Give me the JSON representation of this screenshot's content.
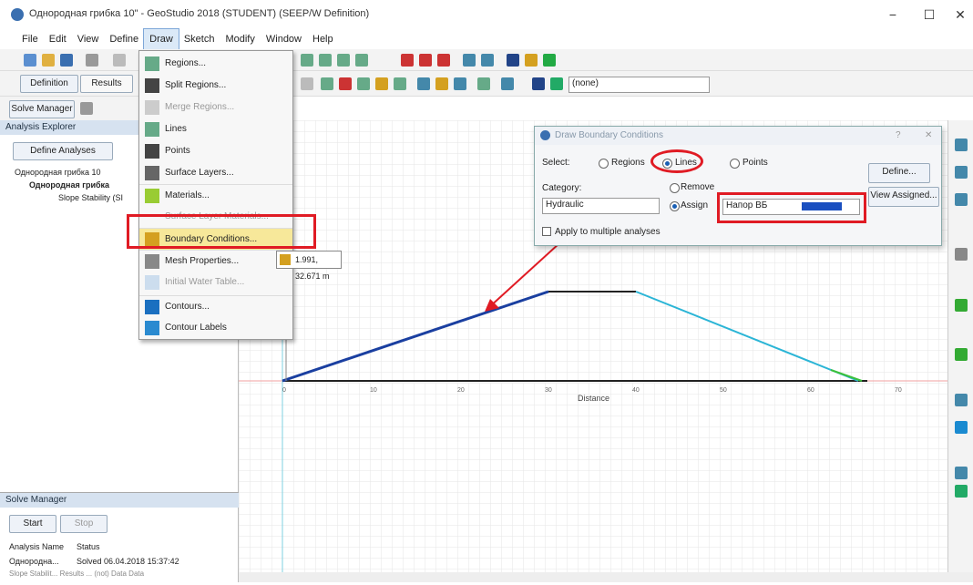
{
  "window": {
    "title": "Однородная грибка 10\" - GeoStudio 2018 (STUDENT) (SEEP/W Definition)",
    "minimize": "−",
    "maximize": "☐",
    "close": "✕"
  },
  "menubar": [
    "File",
    "Edit",
    "View",
    "Define",
    "Draw",
    "Sketch",
    "Modify",
    "Window",
    "Help"
  ],
  "modes": {
    "definition": "Definition",
    "results": "Results"
  },
  "solve_manager_button": "Solve Manager",
  "analysis_explorer": {
    "title": "Analysis Explorer",
    "define_button": "Define Analyses",
    "tree": [
      "Однородная грибка 10",
      "Однородная грибка",
      "Slope Stability (SI"
    ]
  },
  "solve_panel": {
    "title": "Solve Manager",
    "start_button": "Start",
    "stop_button": "Stop",
    "col_name": "Analysis Name",
    "col_status": "Status",
    "row_name": "Однородна...",
    "row_status": "Solved 06.04.2018 15:37:42",
    "row2": "Slope Stabilit... Results ... (not) Data Data"
  },
  "draw_menu": [
    {
      "label": "Regions...",
      "disabled": false
    },
    {
      "label": "Split Regions...",
      "disabled": false
    },
    {
      "label": "Merge Regions...",
      "disabled": true
    },
    {
      "label": "Lines",
      "disabled": false
    },
    {
      "label": "Points",
      "disabled": false
    },
    {
      "label": "Surface Layers...",
      "disabled": false
    },
    {
      "label": "Materials...",
      "disabled": false
    },
    {
      "label": "Surface Layer Materials...",
      "disabled": true
    },
    {
      "label": "Boundary Conditions...",
      "disabled": false,
      "highlighted": true
    },
    {
      "label": "Mesh Properties...",
      "disabled": false
    },
    {
      "label": "Initial Water Table...",
      "disabled": true
    },
    {
      "label": "Contours...",
      "disabled": false
    },
    {
      "label": "Contour Labels",
      "disabled": false
    }
  ],
  "toolbar_dropdown": "(none)",
  "coordinate_readout": "1.991, 32.671 m",
  "dialog": {
    "title": "Draw Boundary Conditions",
    "help": "?",
    "close": "✕",
    "select_label": "Select:",
    "opt_regions": "Regions",
    "opt_lines": "Lines",
    "opt_points": "Points",
    "category_label": "Category:",
    "category_value": "Hydraulic",
    "remove_label": "Remove",
    "assign_label": "Assign",
    "bc_value": "Напор ВБ",
    "bc_color": "#1a4fc0",
    "multi_label": "Apply to multiple analyses",
    "define_button": "Define...",
    "view_assigned_button": "View Assigned..."
  },
  "canvas": {
    "xlabel": "Distance",
    "x_ticks": [
      "0",
      "10",
      "20",
      "30",
      "40",
      "50",
      "60",
      "70"
    ]
  },
  "colors": {
    "accent": "#e01b24",
    "upstream_line": "#1a3fa0",
    "downstream_line": "#2bb5d6",
    "crest_line": "#222222"
  }
}
